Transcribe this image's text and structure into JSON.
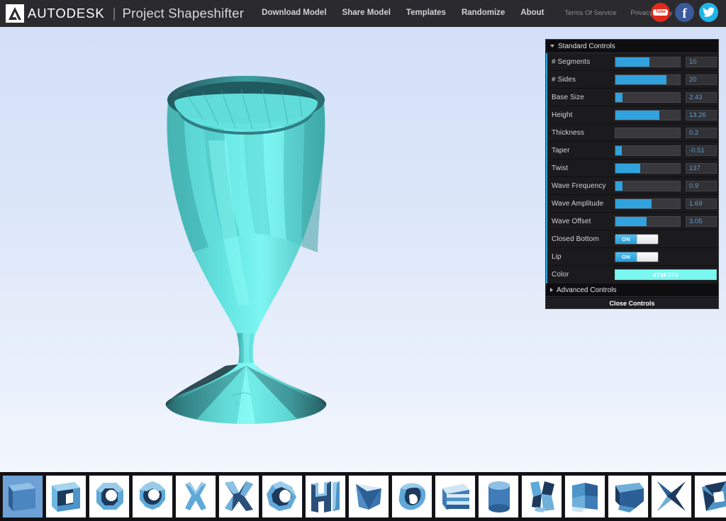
{
  "header": {
    "brand": "AUTODESK",
    "separator": "|",
    "product": "Project Shapeshifter",
    "nav_main": [
      {
        "label": "Download Model",
        "name": "nav-download-model"
      },
      {
        "label": "Share Model",
        "name": "nav-share-model"
      },
      {
        "label": "Templates",
        "name": "nav-templates"
      },
      {
        "label": "Randomize",
        "name": "nav-randomize"
      },
      {
        "label": "About",
        "name": "nav-about"
      }
    ],
    "nav_sub": [
      {
        "label": "Terms Of Service",
        "name": "nav-terms-of-service"
      },
      {
        "label": "Privacy Policy",
        "name": "nav-privacy-policy"
      }
    ],
    "social": [
      {
        "label": "Tube",
        "name": "youtube-icon",
        "color": "#e02a1b"
      },
      {
        "label": "f",
        "name": "facebook-icon",
        "color": "#3b5a9b"
      },
      {
        "label": "twitter",
        "name": "twitter-icon",
        "color": "#1fb4e8"
      }
    ]
  },
  "panel": {
    "standard_header": "Standard Controls",
    "advanced_header": "Advanced Controls",
    "close_label": "Close Controls",
    "accent_color": "#30a2dd",
    "sliders": [
      {
        "label": "# Segments",
        "value": "10",
        "fill_pct": 53
      },
      {
        "label": "# Sides",
        "value": "20",
        "fill_pct": 79
      },
      {
        "label": "Base Size",
        "value": "2.43",
        "fill_pct": 11
      },
      {
        "label": "Height",
        "value": "13.26",
        "fill_pct": 68
      },
      {
        "label": "Thickness",
        "value": "0.2",
        "fill_pct": 0
      },
      {
        "label": "Taper",
        "value": "-0.51",
        "fill_pct": 10
      },
      {
        "label": "Twist",
        "value": "137",
        "fill_pct": 38
      },
      {
        "label": "Wave Frequency",
        "value": "0.9",
        "fill_pct": 11
      },
      {
        "label": "Wave Amplitude",
        "value": "1.69",
        "fill_pct": 56
      },
      {
        "label": "Wave Offset",
        "value": "3.05",
        "fill_pct": 48
      }
    ],
    "toggles": [
      {
        "label": "Closed Bottom",
        "state": "ON"
      },
      {
        "label": "Lip",
        "state": "ON"
      }
    ],
    "color": {
      "label": "Color",
      "value": "#79F7F0",
      "swatch": "#79f7f0"
    }
  },
  "viewport": {
    "model_name": "twisted faceted goblet",
    "model_color": "#5ed9d6",
    "background_top": "#d3e0f7",
    "background_bottom": "#f2f6fd"
  },
  "thumbnails": [
    {
      "name": "template-rounded-cube",
      "selected": true
    },
    {
      "name": "template-square-frame",
      "selected": false
    },
    {
      "name": "template-octagon-ring",
      "selected": false
    },
    {
      "name": "template-gear-ring",
      "selected": false
    },
    {
      "name": "template-cross",
      "selected": false
    },
    {
      "name": "template-twisted-cross",
      "selected": false
    },
    {
      "name": "template-oval-ring",
      "selected": false
    },
    {
      "name": "template-ibeam",
      "selected": false
    },
    {
      "name": "template-wedge",
      "selected": false
    },
    {
      "name": "template-flared-cone",
      "selected": false
    },
    {
      "name": "template-striped-drum",
      "selected": false
    },
    {
      "name": "template-cylinder",
      "selected": false
    },
    {
      "name": "template-hourglass",
      "selected": false
    },
    {
      "name": "template-folded-block",
      "selected": false
    },
    {
      "name": "template-beveled-box",
      "selected": false
    },
    {
      "name": "template-star-concave",
      "selected": false
    },
    {
      "name": "template-tilted-square",
      "selected": false
    }
  ]
}
